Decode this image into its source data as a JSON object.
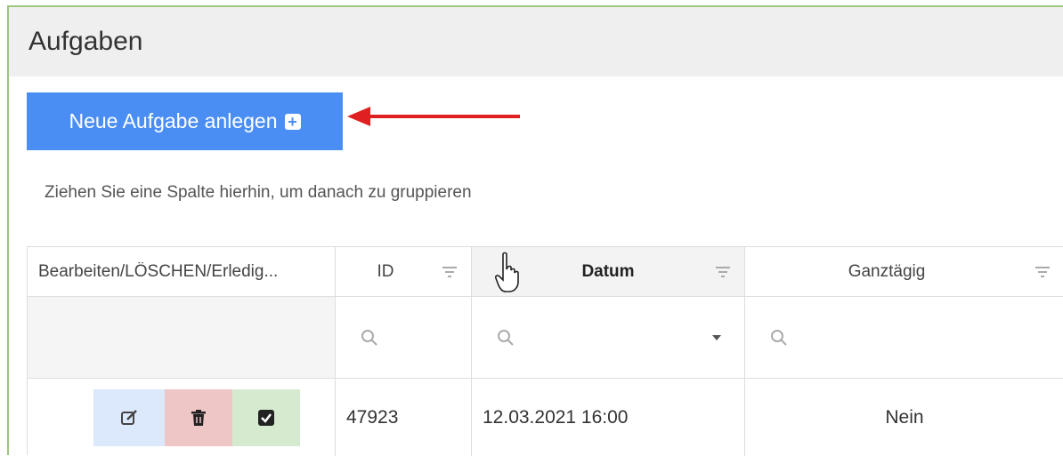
{
  "page": {
    "title": "Aufgaben"
  },
  "toolbar": {
    "new_task_label": "Neue Aufgabe anlegen"
  },
  "grid": {
    "group_hint": "Ziehen Sie eine Spalte hierhin, um danach zu gruppieren",
    "columns": [
      {
        "label": "Bearbeiten/LÖSCHEN/Erledig..."
      },
      {
        "label": "ID"
      },
      {
        "label": "Datum"
      },
      {
        "label": "Ganztägig"
      }
    ],
    "rows": [
      {
        "id": "47923",
        "datum": "12.03.2021 16:00",
        "ganztaegig": "Nein"
      }
    ]
  },
  "icons": {
    "new_task": "plus-square-icon",
    "edit": "edit-icon",
    "delete": "trash-icon",
    "done": "check-square-icon",
    "filter": "filter-icon",
    "search": "search-icon"
  },
  "colors": {
    "accent": "#4a8ef3",
    "annotation_arrow": "#e02020",
    "edit_bg": "#dce8fb",
    "delete_bg": "#efc6c6",
    "done_bg": "#d6ead0",
    "frame_border": "#9bc77e"
  }
}
